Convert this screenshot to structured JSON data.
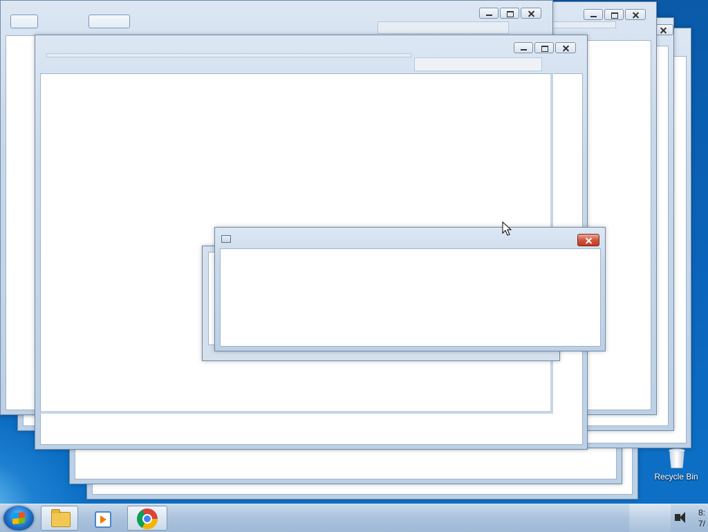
{
  "desktop": {
    "recycle_bin_label": "Recycle Bin"
  },
  "taskbar": {
    "items": [
      {
        "name": "windows-explorer",
        "icon": "folder-icon",
        "active": true
      },
      {
        "name": "windows-media-player",
        "icon": "media-player-icon",
        "active": false
      },
      {
        "name": "google-chrome",
        "icon": "chrome-icon",
        "active": true
      }
    ],
    "clock_time": "8:",
    "clock_date": "7/"
  },
  "windows": {
    "caption_buttons": {
      "minimize": "minimize-icon",
      "maximize": "maximize-icon",
      "close": "close-icon"
    }
  },
  "colors": {
    "desktop_blue": "#0b63b8",
    "chrome_start": "#dce7f3",
    "close_red": "#c9452c"
  }
}
